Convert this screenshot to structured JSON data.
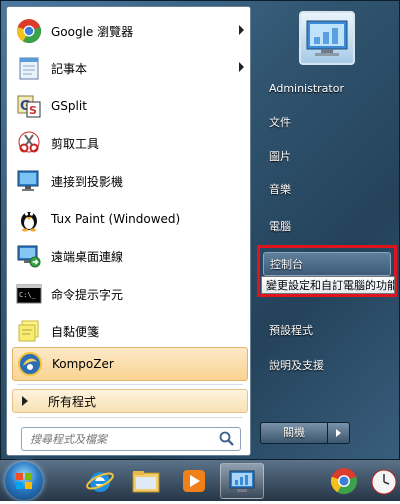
{
  "programs": [
    {
      "label": "Google 瀏覽器",
      "icon": "chrome-icon",
      "submenu": true
    },
    {
      "label": "記事本",
      "icon": "notepad-icon",
      "submenu": true
    },
    {
      "label": "GSplit",
      "icon": "gsplit-icon",
      "submenu": false
    },
    {
      "label": "剪取工具",
      "icon": "scissors-icon",
      "submenu": false
    },
    {
      "label": "連接到投影機",
      "icon": "projector-icon",
      "submenu": false
    },
    {
      "label": "Tux Paint (Windowed)",
      "icon": "tux-penguin-icon",
      "submenu": false
    },
    {
      "label": "遠端桌面連線",
      "icon": "remote-desktop-icon",
      "submenu": false
    },
    {
      "label": "命令提示字元",
      "icon": "command-prompt-icon",
      "submenu": false
    },
    {
      "label": "自黏便箋",
      "icon": "sticky-notes-icon",
      "submenu": false
    },
    {
      "label": "KompoZer",
      "icon": "kompozer-icon",
      "submenu": false
    }
  ],
  "all_programs": "所有程式",
  "search": {
    "placeholder": "搜尋程式及檔案"
  },
  "right": {
    "username": "Administrator",
    "documents": "文件",
    "pictures": "圖片",
    "music": "音樂",
    "computer": "電腦",
    "control_panel": "控制台",
    "control_panel_tooltip": "變更設定和自訂電腦的功能",
    "default_programs": "預設程式",
    "help": "說明及支援"
  },
  "shutdown": {
    "label": "關機"
  },
  "taskbar": [
    "start-orb",
    "internet-explorer-icon",
    "file-explorer-icon",
    "media-player-icon",
    "control-panel-icon",
    "chrome-icon",
    "clock-icon"
  ],
  "colors": {
    "highlight": "#f9d391",
    "annotation_red": "#e0141e"
  }
}
